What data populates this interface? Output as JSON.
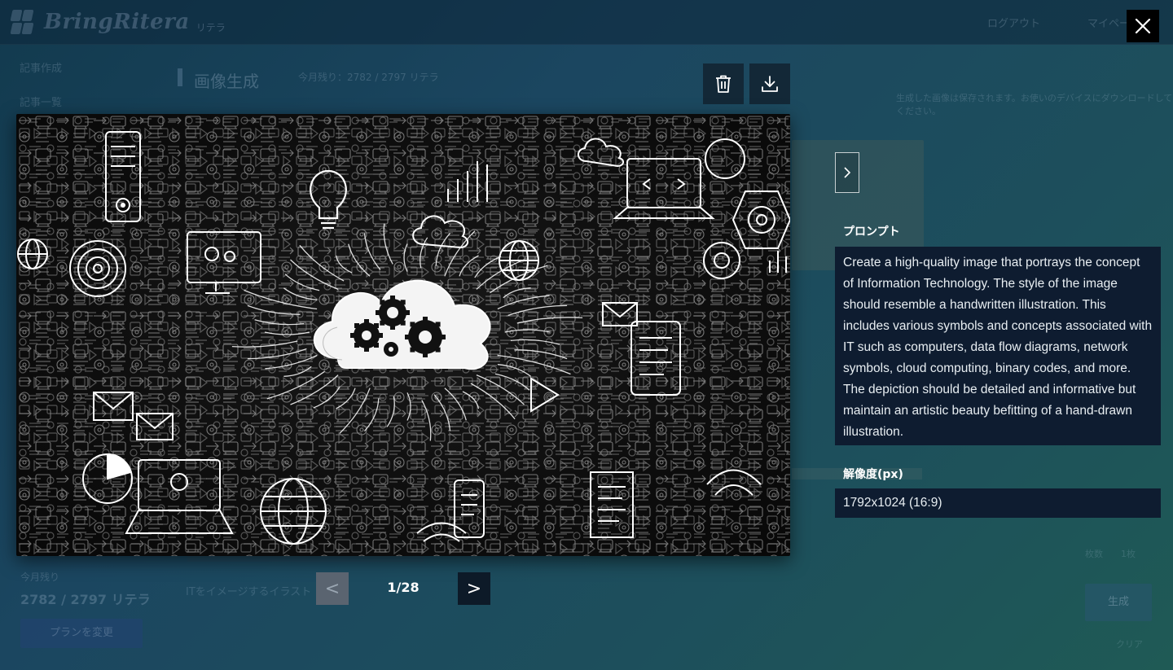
{
  "background_app": {
    "logo_text": "BringRitera",
    "logo_sub": "リテラ",
    "header_links": [
      "ログアウト",
      "マイページ"
    ],
    "sidebar_links": [
      "記事作成",
      "記事一覧"
    ],
    "page_title": "画像生成",
    "page_title_sub": "今月残り：2782 / 2797 リテラ",
    "right_note": "生成した画像は保存されます。お使いのデバイスにダウンロードしてください。",
    "stat_label": "今月残り",
    "stat_value": "2782 / 2797 リテラ",
    "plan_button_label": "プランを変更",
    "input_text": "ITをイメージするイラスト",
    "generate_button_label": "生成",
    "small_labels": [
      "枚数",
      "1枚",
      "クリア"
    ]
  },
  "viewer": {
    "delete_icon": "trash-icon",
    "download_icon": "download-icon",
    "close_icon": "close-icon",
    "pager": {
      "prev_label": "<",
      "next_label": ">",
      "counter": "1/28"
    },
    "side_next_icon": "chevron-right-icon",
    "image_alt": "hand-drawn IT illustration: cloud with gears surrounded by computers, devices, network and data flow symbols"
  },
  "details": {
    "prompt_label": "プロンプト",
    "prompt_text": "Create a high-quality image that portrays the concept of Information Technology. The style of the image should resemble a handwritten illustration. This includes various symbols and concepts associated with IT such as computers, data flow diagrams, network symbols, cloud computing, binary codes, and more. The depiction should be detailed and informative but maintain an artistic beauty befitting of a hand-drawn illustration.",
    "resolution_label": "解像度(px)",
    "resolution_value": "1792x1024 (16:9)"
  },
  "colors": {
    "panel_bg": "#0e1c30",
    "pager_active": "#0d1a28",
    "pager_disabled": "#5a6470",
    "close_bg": "#000000",
    "toolbar_bg": "#12263a"
  }
}
